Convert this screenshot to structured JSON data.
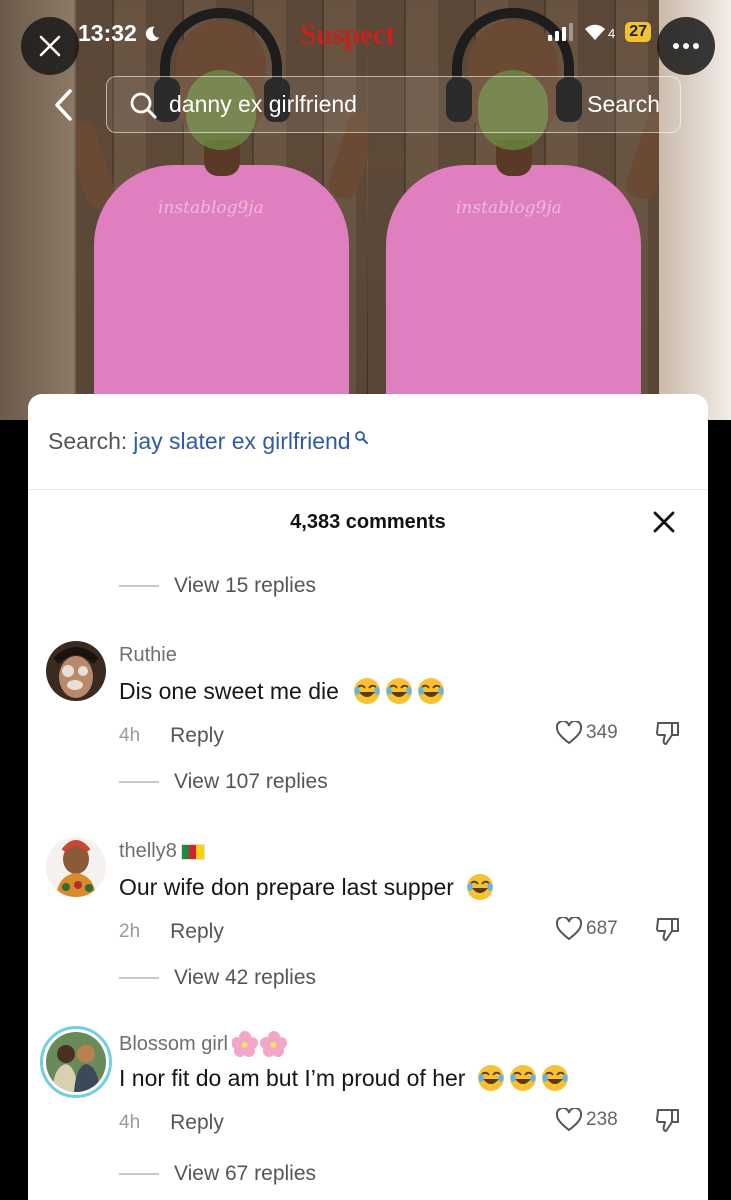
{
  "status_bar": {
    "time": "13:32",
    "wifi_label": "4",
    "battery": "27"
  },
  "video": {
    "overlay_title": "Suspect",
    "watermark": "instablog9ja"
  },
  "search": {
    "query": "danny ex girlfriend",
    "button_label": "Search"
  },
  "sheet": {
    "related_prefix": "Search:",
    "related_term": "jay slater ex girlfriend",
    "comment_count": "4,383 comments",
    "first_view_replies": "View 15 replies",
    "comments": [
      {
        "username": "Ruthie",
        "text": "Dis one sweet me die",
        "emoji_count": 3,
        "age": "4h",
        "reply_label": "Reply",
        "likes": "349",
        "view_replies": "View 107 replies"
      },
      {
        "username": "thelly8",
        "flag": "cameroon",
        "text": "Our wife don prepare last supper",
        "emoji_count": 1,
        "age": "2h",
        "reply_label": "Reply",
        "likes": "687",
        "view_replies": "View 42 replies"
      },
      {
        "username": "Blossom girl",
        "username_emoji": "cherry-blossom",
        "text": "I nor fit do am but I’m proud of her",
        "emoji_count": 3,
        "age": "4h",
        "reply_label": "Reply",
        "likes": "238",
        "view_replies": "View 67 replies"
      }
    ]
  },
  "colors": {
    "link_blue": "#2f5aa8",
    "emoji_yellow": "#f6c234",
    "shirt_pink": "#e07fbf"
  },
  "icons": [
    "close-icon",
    "more-icon",
    "moon-icon",
    "signal-icon",
    "wifi-icon",
    "back-chevron-icon",
    "search-icon",
    "heart-icon",
    "dislike-icon",
    "laughing-emoji-icon"
  ]
}
